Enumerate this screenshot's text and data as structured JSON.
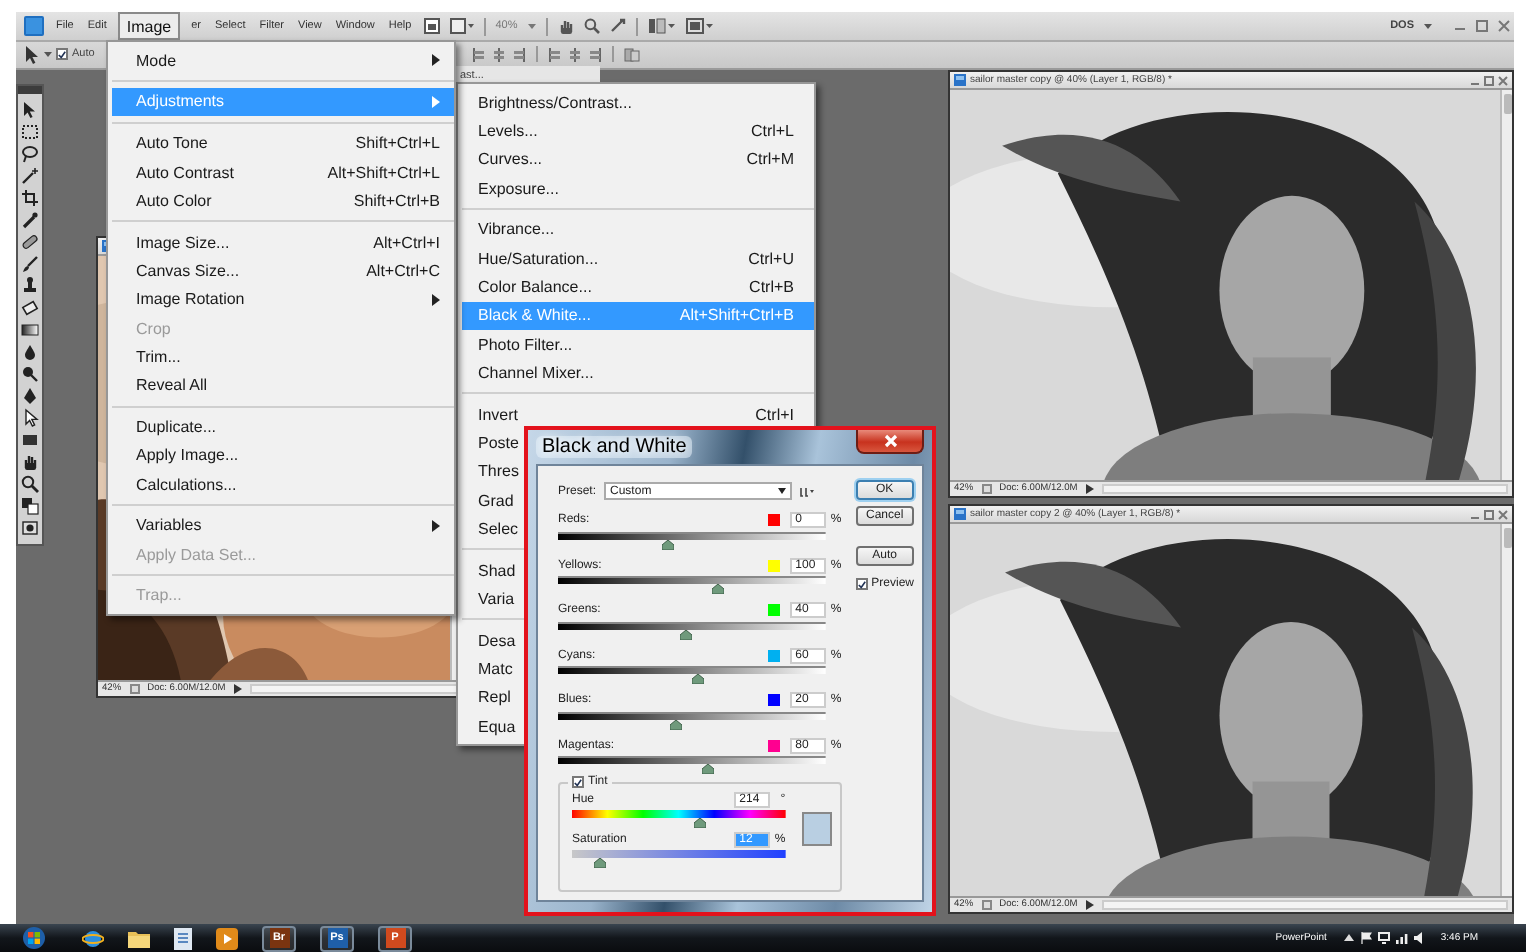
{
  "menubar": {
    "items": [
      {
        "label": "File",
        "selected": false
      },
      {
        "label": "Edit",
        "selected": false
      },
      {
        "label": "Image",
        "selected": true
      },
      {
        "label": "er",
        "selected": false
      },
      {
        "label": "Select",
        "selected": false
      },
      {
        "label": "Filter",
        "selected": false
      },
      {
        "label": "View",
        "selected": false
      },
      {
        "label": "Window",
        "selected": false
      },
      {
        "label": "Help",
        "selected": false
      }
    ],
    "zoom": "40%",
    "workspace": "DOS"
  },
  "options_bar": {
    "auto_select": {
      "label": "Auto",
      "checked": true
    }
  },
  "partial_title": "ast...",
  "image_menu": {
    "items": [
      {
        "kind": "item",
        "label": "Mode",
        "submenu": true,
        "disabled": false,
        "selected": false
      },
      {
        "kind": "separator"
      },
      {
        "kind": "item",
        "label": "Adjustments",
        "submenu": true,
        "disabled": false,
        "selected": true
      },
      {
        "kind": "separator"
      },
      {
        "kind": "item",
        "label": "Auto Tone",
        "shortcut": "Shift+Ctrl+L",
        "submenu": false,
        "disabled": false,
        "selected": false
      },
      {
        "kind": "item",
        "label": "Auto Contrast",
        "shortcut": "Alt+Shift+Ctrl+L",
        "submenu": false,
        "disabled": false,
        "selected": false
      },
      {
        "kind": "item",
        "label": "Auto Color",
        "shortcut": "Shift+Ctrl+B",
        "submenu": false,
        "disabled": false,
        "selected": false
      },
      {
        "kind": "separator"
      },
      {
        "kind": "item",
        "label": "Image Size...",
        "shortcut": "Alt+Ctrl+I",
        "submenu": false,
        "disabled": false,
        "selected": false
      },
      {
        "kind": "item",
        "label": "Canvas Size...",
        "shortcut": "Alt+Ctrl+C",
        "submenu": false,
        "disabled": false,
        "selected": false
      },
      {
        "kind": "item",
        "label": "Image Rotation",
        "submenu": true,
        "disabled": false,
        "selected": false
      },
      {
        "kind": "item",
        "label": "Crop",
        "submenu": false,
        "disabled": true,
        "selected": false
      },
      {
        "kind": "item",
        "label": "Trim...",
        "submenu": false,
        "disabled": false,
        "selected": false
      },
      {
        "kind": "item",
        "label": "Reveal All",
        "submenu": false,
        "disabled": false,
        "selected": false
      },
      {
        "kind": "separator"
      },
      {
        "kind": "item",
        "label": "Duplicate...",
        "submenu": false,
        "disabled": false,
        "selected": false
      },
      {
        "kind": "item",
        "label": "Apply Image...",
        "submenu": false,
        "disabled": false,
        "selected": false
      },
      {
        "kind": "item",
        "label": "Calculations...",
        "submenu": false,
        "disabled": false,
        "selected": false
      },
      {
        "kind": "separator"
      },
      {
        "kind": "item",
        "label": "Variables",
        "submenu": true,
        "disabled": false,
        "selected": false
      },
      {
        "kind": "item",
        "label": "Apply Data Set...",
        "submenu": false,
        "disabled": true,
        "selected": false
      },
      {
        "kind": "separator"
      },
      {
        "kind": "item",
        "label": "Trap...",
        "submenu": false,
        "disabled": true,
        "selected": false
      }
    ]
  },
  "adjustments_menu": {
    "items": [
      {
        "kind": "item",
        "label": "Brightness/Contrast...",
        "submenu": false,
        "disabled": false,
        "selected": false
      },
      {
        "kind": "item",
        "label": "Levels...",
        "shortcut": "Ctrl+L",
        "submenu": false,
        "disabled": false,
        "selected": false
      },
      {
        "kind": "item",
        "label": "Curves...",
        "shortcut": "Ctrl+M",
        "submenu": false,
        "disabled": false,
        "selected": false
      },
      {
        "kind": "item",
        "label": "Exposure...",
        "submenu": false,
        "disabled": false,
        "selected": false
      },
      {
        "kind": "separator"
      },
      {
        "kind": "item",
        "label": "Vibrance...",
        "submenu": false,
        "disabled": false,
        "selected": false
      },
      {
        "kind": "item",
        "label": "Hue/Saturation...",
        "shortcut": "Ctrl+U",
        "submenu": false,
        "disabled": false,
        "selected": false
      },
      {
        "kind": "item",
        "label": "Color Balance...",
        "shortcut": "Ctrl+B",
        "submenu": false,
        "disabled": false,
        "selected": false
      },
      {
        "kind": "item",
        "label": "Black & White...",
        "shortcut": "Alt+Shift+Ctrl+B",
        "submenu": false,
        "disabled": false,
        "selected": true
      },
      {
        "kind": "item",
        "label": "Photo Filter...",
        "submenu": false,
        "disabled": false,
        "selected": false
      },
      {
        "kind": "item",
        "label": "Channel Mixer...",
        "submenu": false,
        "disabled": false,
        "selected": false
      },
      {
        "kind": "separator"
      },
      {
        "kind": "item",
        "label": "Invert",
        "shortcut": "Ctrl+I",
        "submenu": false,
        "disabled": false,
        "selected": false
      },
      {
        "kind": "item",
        "label": "Poste",
        "disabled": false,
        "selected": false
      },
      {
        "kind": "item",
        "label": "Thres",
        "disabled": false,
        "selected": false
      },
      {
        "kind": "item",
        "label": "Grad",
        "disabled": false,
        "selected": false
      },
      {
        "kind": "item",
        "label": "Selec",
        "disabled": false,
        "selected": false
      },
      {
        "kind": "separator"
      },
      {
        "kind": "item",
        "label": "Shad",
        "disabled": false,
        "selected": false
      },
      {
        "kind": "item",
        "label": "Varia",
        "disabled": false,
        "selected": false
      },
      {
        "kind": "separator"
      },
      {
        "kind": "item",
        "label": "Desa",
        "disabled": false,
        "selected": false
      },
      {
        "kind": "item",
        "label": "Matc",
        "disabled": false,
        "selected": false
      },
      {
        "kind": "item",
        "label": "Repl",
        "disabled": false,
        "selected": false
      },
      {
        "kind": "item",
        "label": "Equa",
        "disabled": false,
        "selected": false
      }
    ]
  },
  "documents": [
    {
      "zoom": "42%",
      "size": "Doc: 6.00M/12.0M"
    },
    {
      "title": "sailor master copy @ 40% (Layer 1, RGB/8) *",
      "zoom": "42%",
      "size": "Doc: 6.00M/12.0M"
    },
    {
      "title": "sailor master copy 2 @ 40% (Layer 1, RGB/8) *",
      "zoom": "42%",
      "size": "Doc: 6.00M/12.0M"
    }
  ],
  "dialog": {
    "title": "Black and White",
    "preset_label": "Preset:",
    "preset": "Custom",
    "sliders": [
      {
        "label": "Reds:",
        "color": "#ff0000",
        "value": "0",
        "unit": "%",
        "level": 0.41
      },
      {
        "label": "Yellows:",
        "color": "#ffff00",
        "value": "100",
        "unit": "%",
        "level": 0.6
      },
      {
        "label": "Greens:",
        "color": "#00ff00",
        "value": "40",
        "unit": "%",
        "level": 0.48
      },
      {
        "label": "Cyans:",
        "color": "#00b0f0",
        "value": "60",
        "unit": "%",
        "level": 0.52
      },
      {
        "label": "Blues:",
        "color": "#0000ff",
        "value": "20",
        "unit": "%",
        "level": 0.44
      },
      {
        "label": "Magentas:",
        "color": "#ff0090",
        "value": "80",
        "unit": "%",
        "level": 0.56
      }
    ],
    "buttons": [
      {
        "label": "OK",
        "default": true
      },
      {
        "label": "Cancel",
        "default": false
      },
      {
        "label": "Auto",
        "default": false
      }
    ],
    "preview": {
      "label": "Preview",
      "checked": true
    },
    "tint": {
      "label": "Tint",
      "checked": true,
      "color": "#b9cfe2",
      "hue": {
        "label": "Hue",
        "value": "214",
        "unit": "°",
        "level": 0.6
      },
      "saturation": {
        "label": "Saturation",
        "value": "12",
        "unit": "%",
        "level": 0.13,
        "selected": true
      }
    }
  },
  "taskbar": {
    "apps": [
      {
        "label": "Br",
        "color": "#7a3410"
      },
      {
        "label": "Ps",
        "color": "#1f5fa8"
      },
      {
        "label": "P",
        "color": "#d04a1e"
      }
    ],
    "tray_label": "PowerPoint",
    "time": "3:46 PM"
  }
}
